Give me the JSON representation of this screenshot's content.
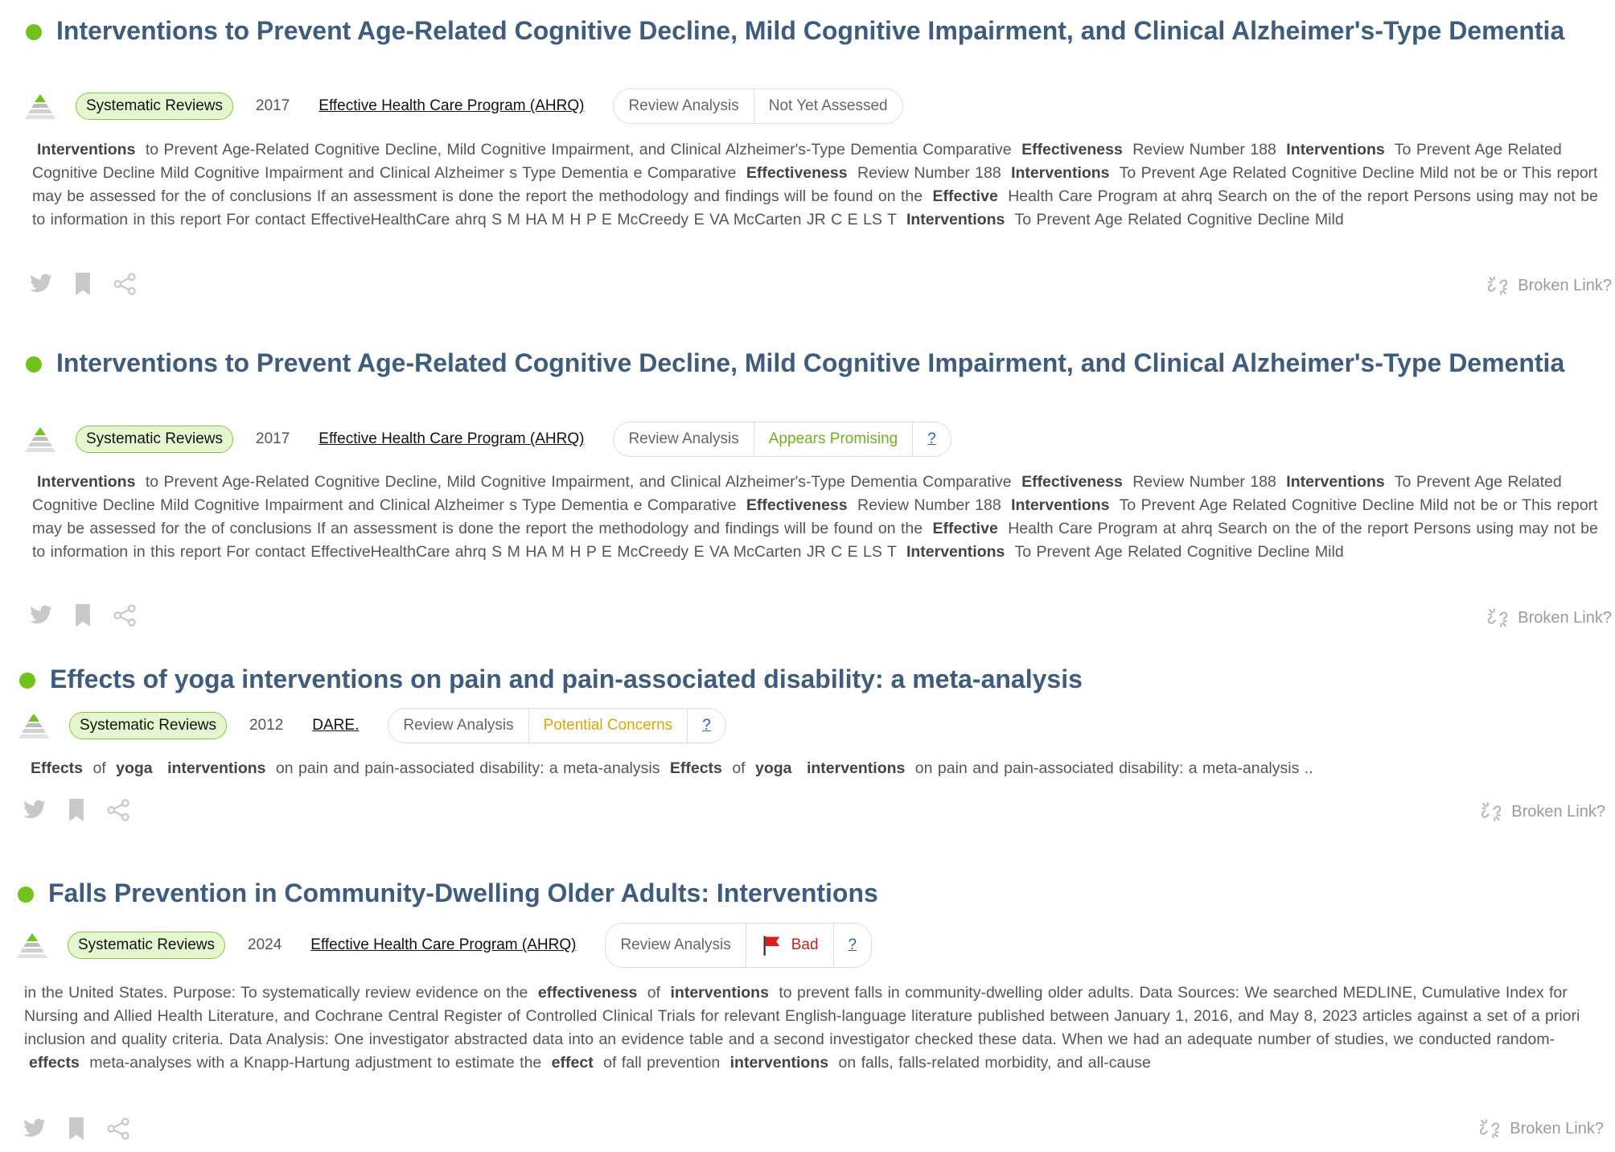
{
  "results": [
    {
      "title": "Interventions to Prevent Age-Related Cognitive Decline, Mild Cognitive Impairment, and Clinical Alzheimer's-Type Dementia",
      "badge": "Systematic Reviews",
      "year": "2017",
      "source": "Effective Health Care Program (AHRQ)",
      "review_label": "Review Analysis",
      "review_status": "Not Yet Assessed",
      "status_kind": "neutral",
      "help": "",
      "snippet": [
        {
          "t": "Interventions",
          "b": true
        },
        {
          "t": " to Prevent Age-Related Cognitive Decline, Mild Cognitive Impairment, and Clinical Alzheimer's-Type Dementia Comparative "
        },
        {
          "t": "Effectiveness",
          "b": true
        },
        {
          "t": " Review Number 188 "
        },
        {
          "t": "Interventions",
          "b": true
        },
        {
          "t": " To Prevent Age Related Cognitive Decline Mild Cognitive Impairment and Clinical Alzheimer s Type Dementia e Comparative "
        },
        {
          "t": "Effectiveness",
          "b": true
        },
        {
          "t": " Review Number 188 "
        },
        {
          "t": "Interventions",
          "b": true
        },
        {
          "t": " To Prevent Age Related Cognitive Decline Mild not be or This report may be assessed for the of conclusions If an assessment is done the report the methodology and findings will be found on the "
        },
        {
          "t": "Effective",
          "b": true
        },
        {
          "t": " Health Care Program at ahrq Search on the of the report Persons using may not be to information in this report For contact EffectiveHealthCare ahrq S M HA M H P E McCreedy E VA McCarten JR C E LS T "
        },
        {
          "t": "Interventions",
          "b": true
        },
        {
          "t": " To Prevent Age Related Cognitive Decline Mild"
        }
      ],
      "broken_link": "Broken Link?"
    },
    {
      "title": "Interventions to Prevent Age-Related Cognitive Decline, Mild Cognitive Impairment, and Clinical Alzheimer's-Type Dementia",
      "badge": "Systematic Reviews",
      "year": "2017",
      "source": "Effective Health Care Program (AHRQ)",
      "review_label": "Review Analysis",
      "review_status": "Appears Promising",
      "status_kind": "green",
      "help": "?",
      "snippet": [
        {
          "t": "Interventions",
          "b": true
        },
        {
          "t": " to Prevent Age-Related Cognitive Decline, Mild Cognitive Impairment, and Clinical Alzheimer's-Type Dementia Comparative "
        },
        {
          "t": "Effectiveness",
          "b": true
        },
        {
          "t": " Review Number 188 "
        },
        {
          "t": "Interventions",
          "b": true
        },
        {
          "t": " To Prevent Age Related Cognitive Decline Mild Cognitive Impairment and Clinical Alzheimer s Type Dementia e Comparative "
        },
        {
          "t": "Effectiveness",
          "b": true
        },
        {
          "t": " Review Number 188 "
        },
        {
          "t": "Interventions",
          "b": true
        },
        {
          "t": " To Prevent Age Related Cognitive Decline Mild not be or This report may be assessed for the of conclusions If an assessment is done the report the methodology and findings will be found on the "
        },
        {
          "t": "Effective",
          "b": true
        },
        {
          "t": " Health Care Program at ahrq Search on the of the report Persons using may not be to information in this report For contact EffectiveHealthCare ahrq S M HA M H P E McCreedy E VA McCarten JR C E LS T "
        },
        {
          "t": "Interventions",
          "b": true
        },
        {
          "t": " To Prevent Age Related Cognitive Decline Mild"
        }
      ],
      "broken_link": "Broken Link?"
    },
    {
      "title": "Effects of yoga interventions on pain and pain-associated disability: a meta-analysis",
      "badge": "Systematic Reviews",
      "year": "2012",
      "source": "DARE.",
      "review_label": "Review Analysis",
      "review_status": "Potential Concerns",
      "status_kind": "orange",
      "help": "?",
      "snippet": [
        {
          "t": "Effects",
          "b": true
        },
        {
          "t": " of "
        },
        {
          "t": "yoga",
          "b": true
        },
        {
          "t": " "
        },
        {
          "t": "interventions",
          "b": true
        },
        {
          "t": " on pain and pain-associated disability: a meta-analysis "
        },
        {
          "t": "Effects",
          "b": true
        },
        {
          "t": " of "
        },
        {
          "t": "yoga",
          "b": true
        },
        {
          "t": " "
        },
        {
          "t": "interventions",
          "b": true
        },
        {
          "t": " on pain and pain-associated disability: a meta-analysis .."
        }
      ],
      "broken_link": "Broken Link?"
    },
    {
      "title": "Falls Prevention in Community-Dwelling Older Adults: Interventions",
      "badge": "Systematic Reviews",
      "year": "2024",
      "source": "Effective Health Care Program (AHRQ)",
      "review_label": "Review Analysis",
      "review_status": "Bad",
      "status_kind": "bad",
      "help": "?",
      "snippet": [
        {
          "t": "in the United States. Purpose: To systematically review evidence on the "
        },
        {
          "t": "effectiveness",
          "b": true
        },
        {
          "t": " of "
        },
        {
          "t": "interventions",
          "b": true
        },
        {
          "t": " to prevent falls in community-dwelling older adults. Data Sources: We searched MEDLINE, Cumulative Index for Nursing and Allied Health Literature, and Cochrane Central Register of Controlled Clinical Trials for relevant English-language literature published between January 1, 2016, and May 8, 2023 articles against a set of a priori inclusion and quality criteria. Data Analysis: One investigator abstracted data into an evidence table and a second investigator checked these data. When we had an adequate number of studies, we conducted random- "
        },
        {
          "t": "effects",
          "b": true
        },
        {
          "t": " meta-analyses with a Knapp-Hartung adjustment to estimate the "
        },
        {
          "t": "effect",
          "b": true
        },
        {
          "t": " of fall prevention "
        },
        {
          "t": "interventions",
          "b": true
        },
        {
          "t": " on falls, falls-related morbidity, and all-cause"
        }
      ],
      "broken_link": "Broken Link?"
    }
  ],
  "colors": {
    "title": "#3e5c7e",
    "dot": "#71c21c",
    "badge_bg": "#e6f6cf",
    "badge_border": "#7fca3a",
    "status_green": "#71b01f",
    "status_orange": "#e4a300",
    "status_bad": "#b22222",
    "help_link": "#2a5bd7",
    "icon_gray": "#c8c8c8"
  },
  "icons": {
    "evidence": "pyramid-icon",
    "share_twitter": "twitter-icon",
    "save": "bookmark-icon",
    "share": "share-icon",
    "broken_link": "broken-link-icon",
    "bad_flag": "red-flag-icon"
  }
}
